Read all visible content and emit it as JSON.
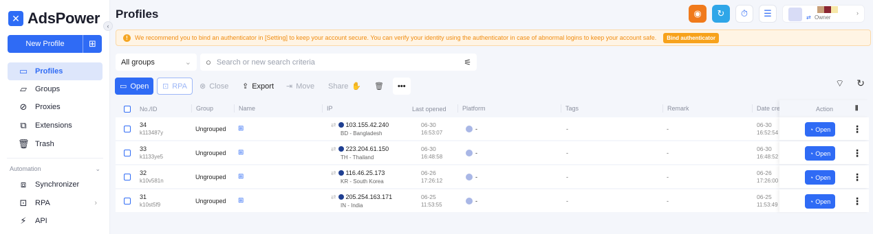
{
  "app": {
    "name": "AdsPower"
  },
  "sidebar": {
    "new_profile": "New Profile",
    "items": [
      {
        "label": "Profiles",
        "icon": "window-icon"
      },
      {
        "label": "Groups",
        "icon": "folder-icon"
      },
      {
        "label": "Proxies",
        "icon": "proxy-icon"
      },
      {
        "label": "Extensions",
        "icon": "puzzle-icon"
      },
      {
        "label": "Trash",
        "icon": "trash-icon"
      }
    ],
    "section": "Automation",
    "automation_items": [
      {
        "label": "Synchronizer",
        "icon": "sync-icon"
      },
      {
        "label": "RPA",
        "icon": "rpa-icon"
      },
      {
        "label": "API",
        "icon": "api-icon"
      }
    ]
  },
  "header": {
    "title": "Profiles",
    "role": "Owner"
  },
  "banner": {
    "message": "We recommend you to bind an authenticator in [Setting] to keep your account secure. You can verify your identity using the authenticator in case of abnormal logins to keep your account safe.",
    "button": "Bind authenticator"
  },
  "filters": {
    "group": "All groups",
    "search_placeholder": "Search or new search criteria"
  },
  "toolbar": {
    "open": "Open",
    "rpa": "RPA",
    "close": "Close",
    "export": "Export",
    "move": "Move",
    "share": "Share"
  },
  "table": {
    "headers": {
      "no": "No./ID",
      "group": "Group",
      "name": "Name",
      "ip": "IP",
      "last_opened": "Last opened",
      "platform": "Platform",
      "tags": "Tags",
      "remark": "Remark",
      "date": "Date cre",
      "action": "Action"
    },
    "rows": [
      {
        "no": "34",
        "id": "k113487y",
        "group": "Ungrouped",
        "ip": "103.155.42.240",
        "location": "BD - Bangladesh",
        "last_date": "06-30",
        "last_time": "16:53:07",
        "platform": "-",
        "tags": "-",
        "remark": "-",
        "created_date": "06-30",
        "created_time": "16:52:54",
        "action": "Open"
      },
      {
        "no": "33",
        "id": "k1133ye5",
        "group": "Ungrouped",
        "ip": "223.204.61.150",
        "location": "TH - Thailand",
        "last_date": "06-30",
        "last_time": "16:48:58",
        "platform": "-",
        "tags": "-",
        "remark": "-",
        "created_date": "06-30",
        "created_time": "16:48:52",
        "action": "Open"
      },
      {
        "no": "32",
        "id": "k10v581n",
        "group": "Ungrouped",
        "ip": "116.46.25.173",
        "location": "KR - South Korea",
        "last_date": "06-26",
        "last_time": "17:26:12",
        "platform": "-",
        "tags": "-",
        "remark": "-",
        "created_date": "06-26",
        "created_time": "17:26:00",
        "action": "Open"
      },
      {
        "no": "31",
        "id": "k10st5f9",
        "group": "Ungrouped",
        "ip": "205.254.163.171",
        "location": "IN - India",
        "last_date": "06-25",
        "last_time": "11:53:55",
        "platform": "-",
        "tags": "-",
        "remark": "-",
        "created_date": "06-25",
        "created_time": "11:53:49",
        "action": "Open"
      }
    ]
  }
}
